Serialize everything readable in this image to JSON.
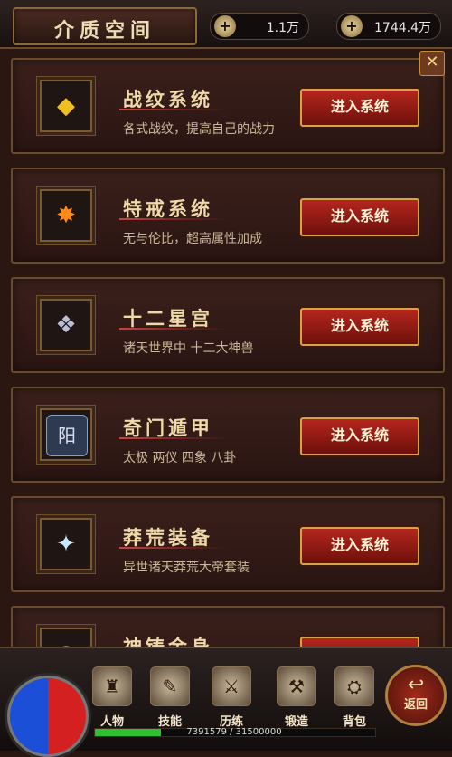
{
  "header": {
    "title": "介质空间",
    "coins": {
      "icon": "coin-icon",
      "value": "1.1万"
    },
    "ingots": {
      "icon": "gold-ingot-icon",
      "value": "1744.4万"
    }
  },
  "cards": [
    {
      "title": "战纹系统",
      "desc": "各式战纹，提高自己的战力",
      "button": "进入系统",
      "icon": "battle-pattern-icon",
      "icon_glyph": "◆",
      "icon_color": "#f0c020"
    },
    {
      "title": "特戒系统",
      "desc": "无与伦比，超高属性加成",
      "button": "进入系统",
      "icon": "special-ring-icon",
      "icon_glyph": "✸",
      "icon_color": "#ff8a1a"
    },
    {
      "title": "十二星宫",
      "desc": "诸天世界中 十二大神兽",
      "button": "进入系统",
      "icon": "dragon-head-icon",
      "icon_glyph": "❖",
      "icon_color": "#b9c0d6"
    },
    {
      "title": "奇门遁甲",
      "desc": "太极 两仪 四象 八卦",
      "button": "进入系统",
      "icon": "yang-badge-icon",
      "icon_glyph": "阳",
      "icon_color": "#d8e0f0"
    },
    {
      "title": "莽荒装备",
      "desc": "异世诸天莽荒大帝套装",
      "button": "进入系统",
      "icon": "armor-icon",
      "icon_glyph": "✦",
      "icon_color": "#c8e8ff"
    },
    {
      "title": "神铸金身",
      "desc": "",
      "button": "",
      "icon": "golden-body-icon",
      "icon_glyph": "◉",
      "icon_color": "#e07a30"
    }
  ],
  "nav": [
    {
      "label": "人物",
      "icon": "character-icon",
      "glyph": "♜"
    },
    {
      "label": "技能",
      "icon": "skill-book-icon",
      "glyph": "✎"
    },
    {
      "label": "历练",
      "icon": "training-icon",
      "glyph": "⚔"
    },
    {
      "label": "锻造",
      "icon": "anvil-icon",
      "glyph": "⚒"
    },
    {
      "label": "背包",
      "icon": "backpack-icon",
      "glyph": "⛭"
    }
  ],
  "back": {
    "label": "返回",
    "icon": "return-arrow-icon"
  },
  "exp": {
    "text": "7391579 / 31500000",
    "current": 7391579,
    "max": 31500000
  },
  "close": {
    "icon": "close-icon",
    "glyph": "✕"
  }
}
